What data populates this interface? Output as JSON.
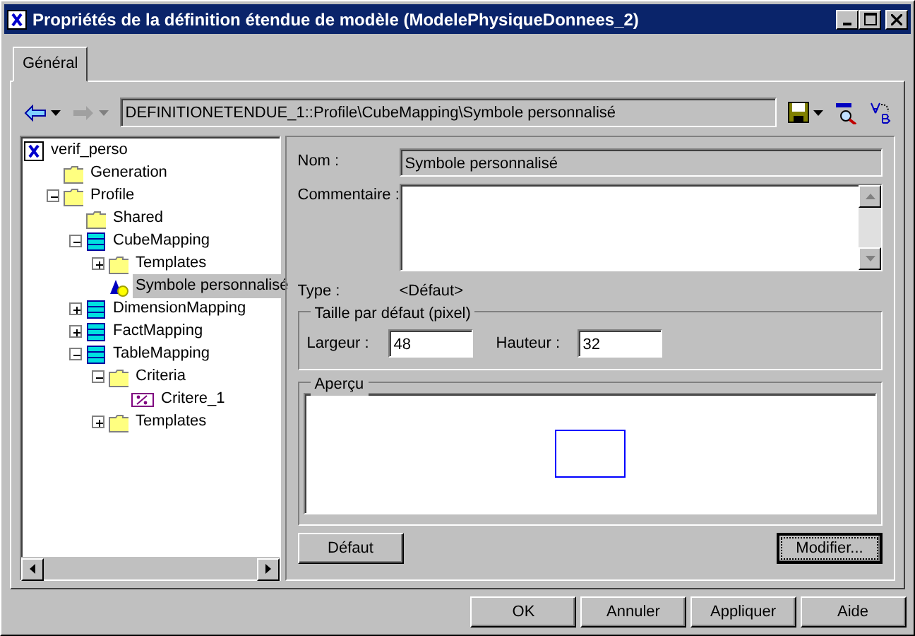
{
  "window": {
    "title": "Propriétés de la définition étendue de modèle (ModelePhysiqueDonnees_2)"
  },
  "tabs": [
    {
      "label": "Général",
      "selected": true
    }
  ],
  "toolbar": {
    "path": "DEFINITIONETENDUE_1::Profile\\CubeMapping\\Symbole personnalisé",
    "forward_disabled": true
  },
  "tree": [
    {
      "label": "verif_perso",
      "kind": "model",
      "selected": false,
      "children": [
        {
          "label": "Generation",
          "kind": "folder",
          "selected": false
        },
        {
          "label": "Profile",
          "kind": "folder",
          "expanded": true,
          "selected": false,
          "children": [
            {
              "label": "Shared",
              "kind": "folder",
              "selected": false
            },
            {
              "label": "CubeMapping",
              "kind": "table",
              "expanded": true,
              "selected": false,
              "children": [
                {
                  "label": "Templates",
                  "kind": "folder",
                  "expanded": false,
                  "selected": false
                },
                {
                  "label": "Symbole personnalisé",
                  "kind": "symbol",
                  "selected": true
                }
              ]
            },
            {
              "label": "DimensionMapping",
              "kind": "table",
              "expanded": false,
              "selected": false
            },
            {
              "label": "FactMapping",
              "kind": "table",
              "expanded": false,
              "selected": false
            },
            {
              "label": "TableMapping",
              "kind": "table",
              "expanded": true,
              "selected": false,
              "children": [
                {
                  "label": "Criteria",
                  "kind": "folder",
                  "expanded": true,
                  "selected": false,
                  "children": [
                    {
                      "label": "Critere_1",
                      "kind": "criterion",
                      "selected": false
                    }
                  ]
                },
                {
                  "label": "Templates",
                  "kind": "folder",
                  "expanded": false,
                  "selected": false
                }
              ]
            }
          ]
        }
      ]
    }
  ],
  "form": {
    "name_label": "Nom :",
    "name_value": "Symbole personnalisé",
    "comment_label": "Commentaire :",
    "type_label": "Type :",
    "type_value": "<Défaut>",
    "size_group": "Taille par défaut (pixel)",
    "width_label": "Largeur :",
    "width_value": "48",
    "height_label": "Hauteur :",
    "height_value": "32",
    "preview_group": "Aperçu",
    "default_button": "Défaut",
    "modify_button": "Modifier..."
  },
  "buttons": [
    "OK",
    "Annuler",
    "Appliquer",
    "Aide"
  ]
}
